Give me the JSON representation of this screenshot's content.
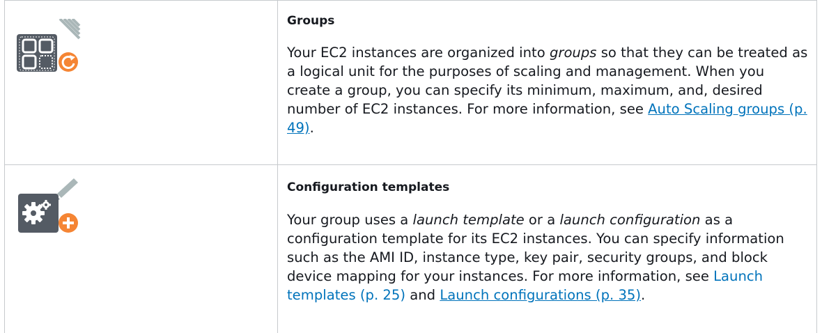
{
  "rows": [
    {
      "icon": "auto-scaling-group-icon",
      "heading": "Groups",
      "p_a": "Your EC2 instances are organized into ",
      "p_em": "groups",
      "p_b": " so that they can be treated as a logical unit for the purposes of scaling and management. When you create a group, you can specify its minimum, maximum, and, desired number of EC2 instances. For more information, see ",
      "link": "Auto Scaling groups (p. 49)",
      "p_c": "."
    },
    {
      "icon": "configuration-template-icon",
      "heading": "Configuration templates",
      "p_a": "Your group uses a ",
      "p_em1": "launch template",
      "p_b": " or a ",
      "p_em2": "launch configuration",
      "p_c": " as a configuration template for its EC2 instances. You can specify information such as the AMI ID, instance type, key pair, security groups, and block device mapping for your instances. For more information, see ",
      "link1": "Launch templates (p. 25)",
      "p_d": " and ",
      "link2": "Launch configurations (p. 35)",
      "p_e": "."
    }
  ],
  "colors": {
    "border": "#c7cacd",
    "link": "#0073bb",
    "icon_dark": "#545b64",
    "icon_accent": "#f58534",
    "icon_stripe": "#aab7b8"
  }
}
